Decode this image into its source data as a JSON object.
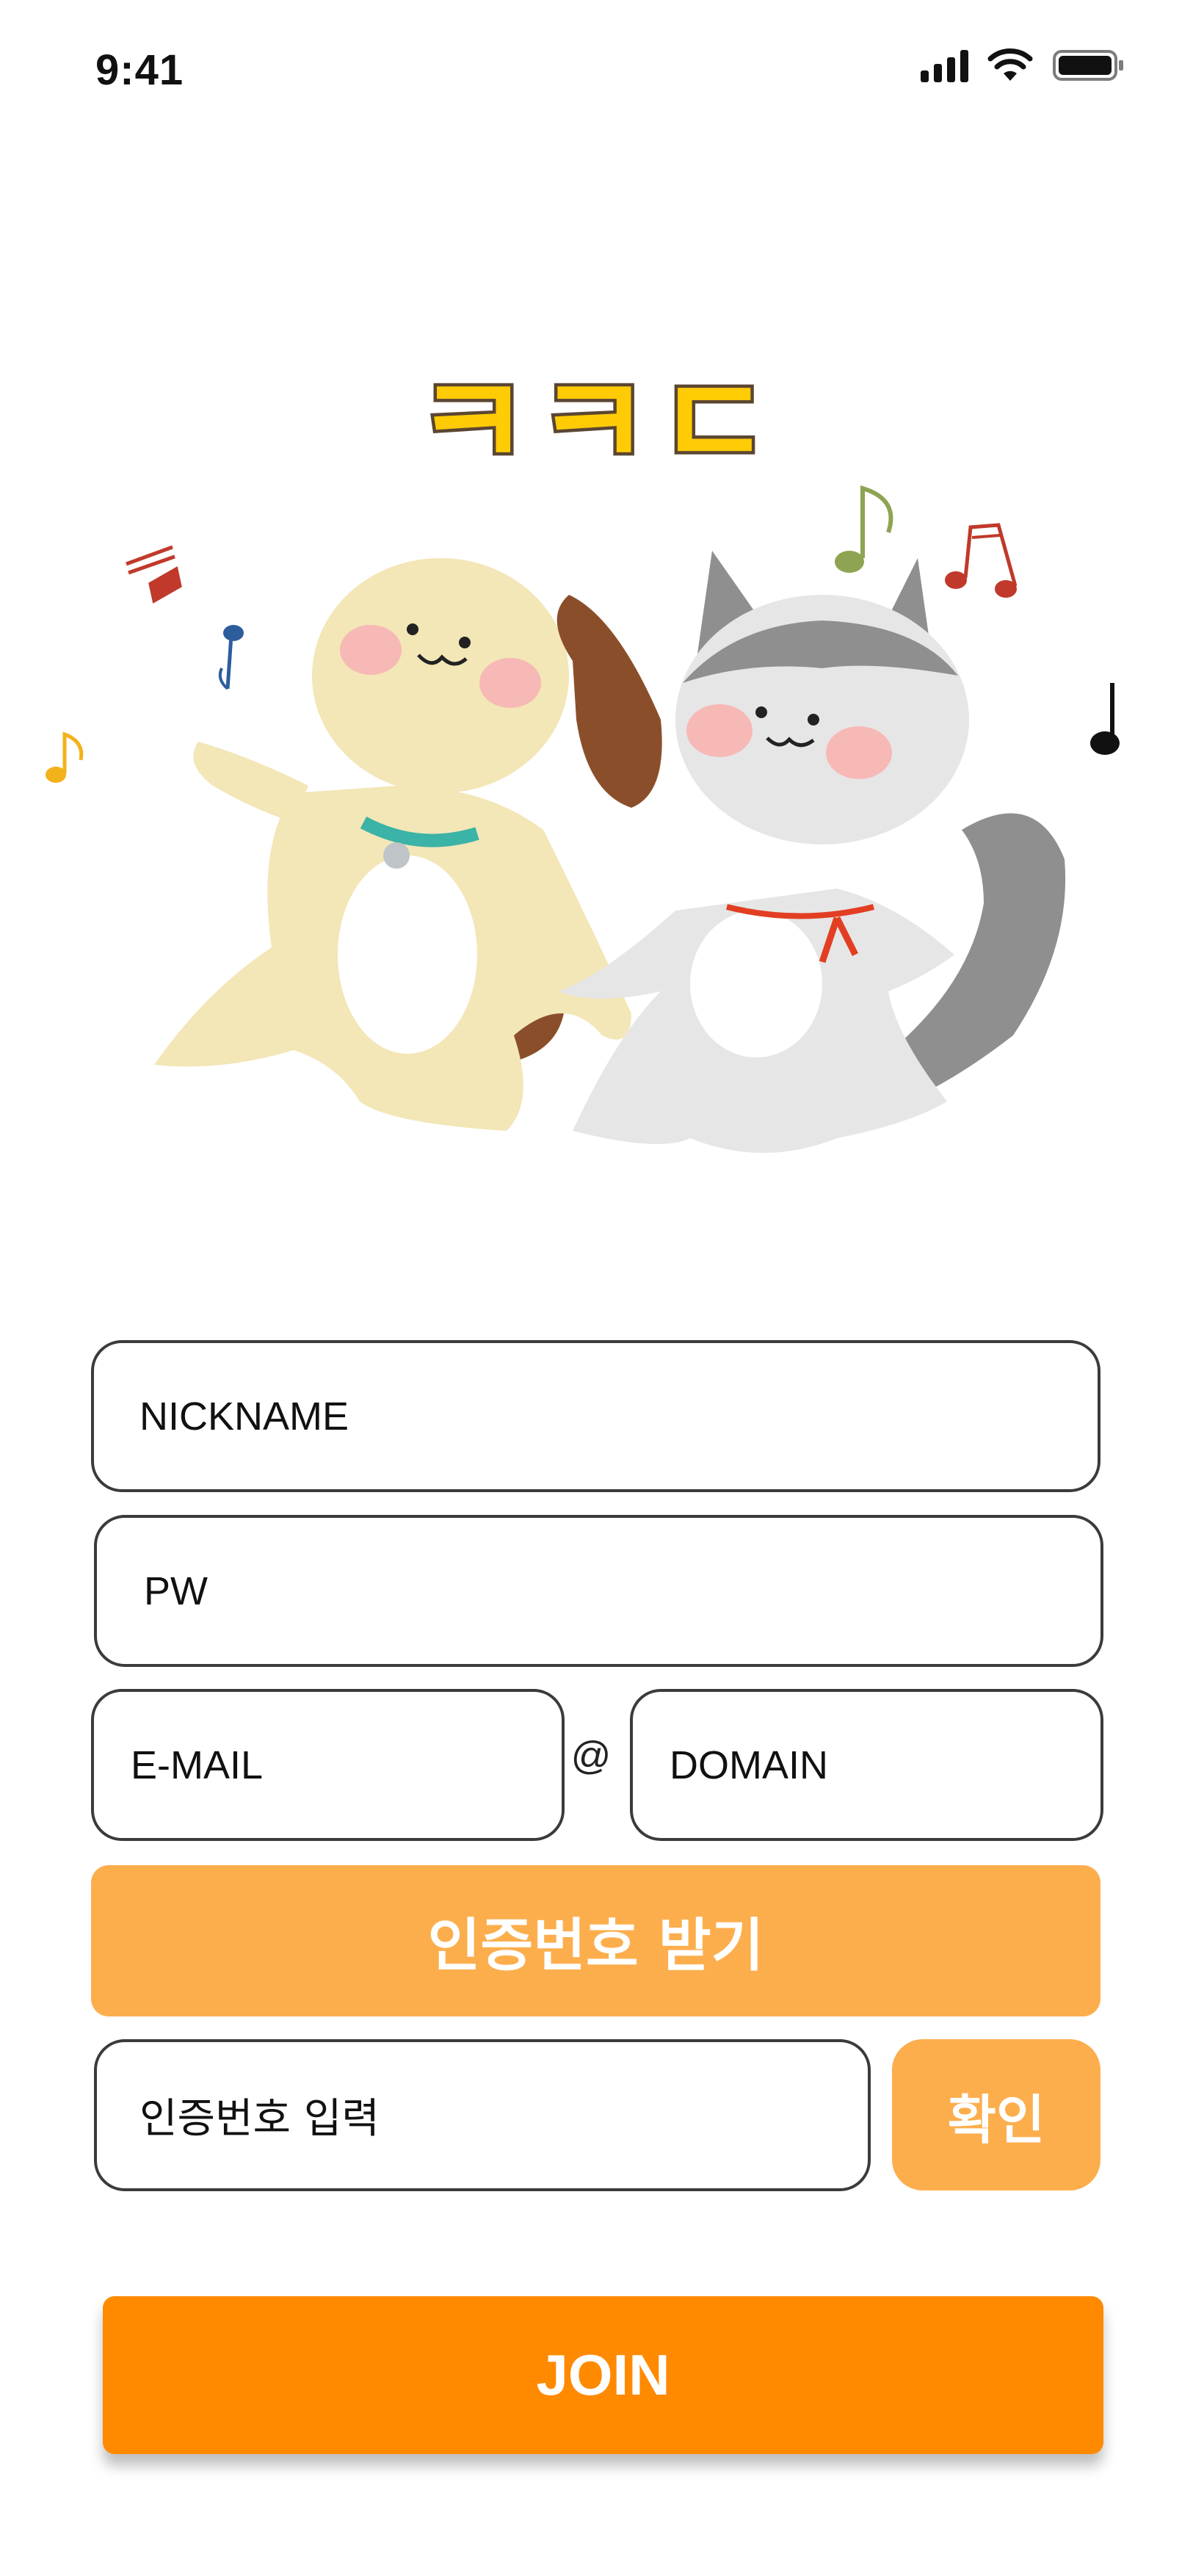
{
  "status_bar": {
    "time": "9:41"
  },
  "app": {
    "logo_text": "ㅋㅋㄷ"
  },
  "form": {
    "nickname_placeholder": "NICKNAME",
    "password_placeholder": "PW",
    "email_placeholder": "E-MAIL",
    "at_sign": "@",
    "domain_placeholder": "DOMAIN",
    "request_code_label": "인증번호 받기",
    "code_placeholder": "인증번호 입력",
    "confirm_label": "확인",
    "join_label": "JOIN"
  },
  "colors": {
    "logo_fill": "#ffcb05",
    "logo_outline": "#5b4632",
    "light_orange": "#fcae4d",
    "join_orange": "#ff8a00",
    "field_border": "#3b3b3b"
  },
  "icons": [
    "cellular-signal-icon",
    "wifi-icon",
    "battery-icon"
  ]
}
